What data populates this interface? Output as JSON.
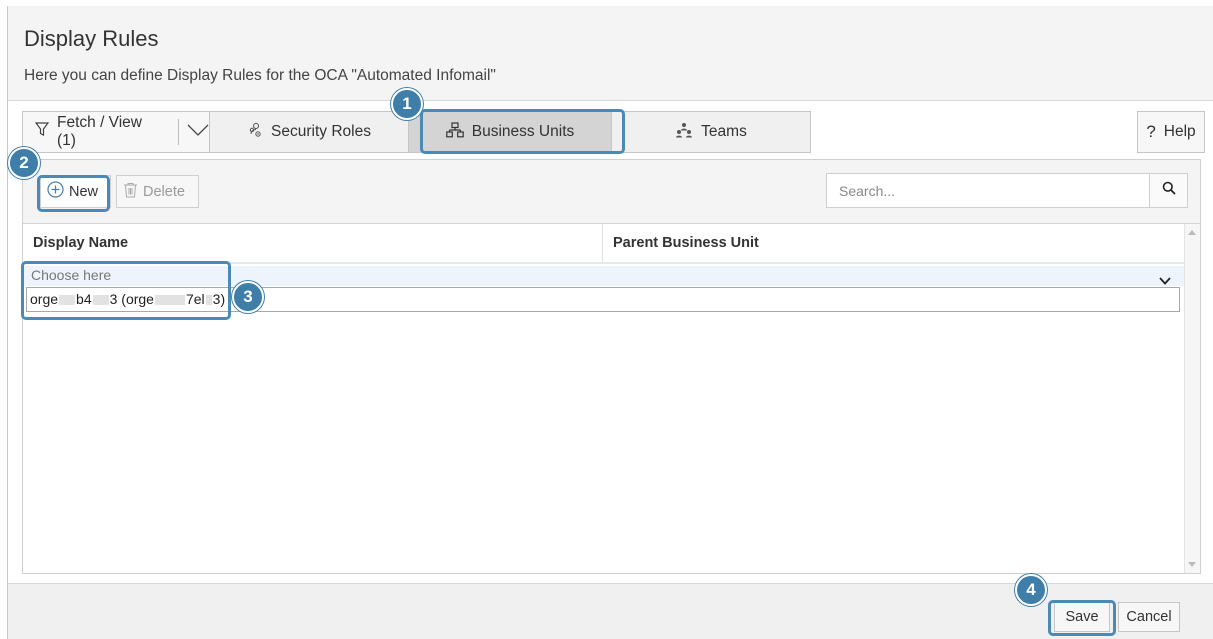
{
  "header": {
    "title": "Display Rules",
    "subtitle": "Here you can define Display Rules for the OCA \"Automated Infomail\""
  },
  "tabs": {
    "fetch_label": "Fetch / View (1)",
    "security_label": "Security Roles",
    "business_units_label": "Business Units",
    "teams_label": "Teams",
    "active": "Business Units"
  },
  "help": {
    "symbol": "?",
    "label": "Help"
  },
  "toolbar": {
    "new_label": "New",
    "delete_label": "Delete"
  },
  "search": {
    "placeholder": "Search..."
  },
  "table": {
    "columns": [
      "Display Name",
      "Parent Business Unit"
    ],
    "edit_row": {
      "placeholder": "Choose here",
      "option": {
        "part1": "orge",
        "part2": "b4",
        "part3": "3 (orge",
        "part4": "7el",
        "part5": "3)"
      }
    }
  },
  "footer": {
    "save_label": "Save",
    "cancel_label": "Cancel"
  },
  "callouts": [
    "1",
    "2",
    "3",
    "4"
  ],
  "colors": {
    "accent": "#4a8ab5",
    "badge": "#3e7ea8",
    "active_tab": "#d4d4d4"
  }
}
